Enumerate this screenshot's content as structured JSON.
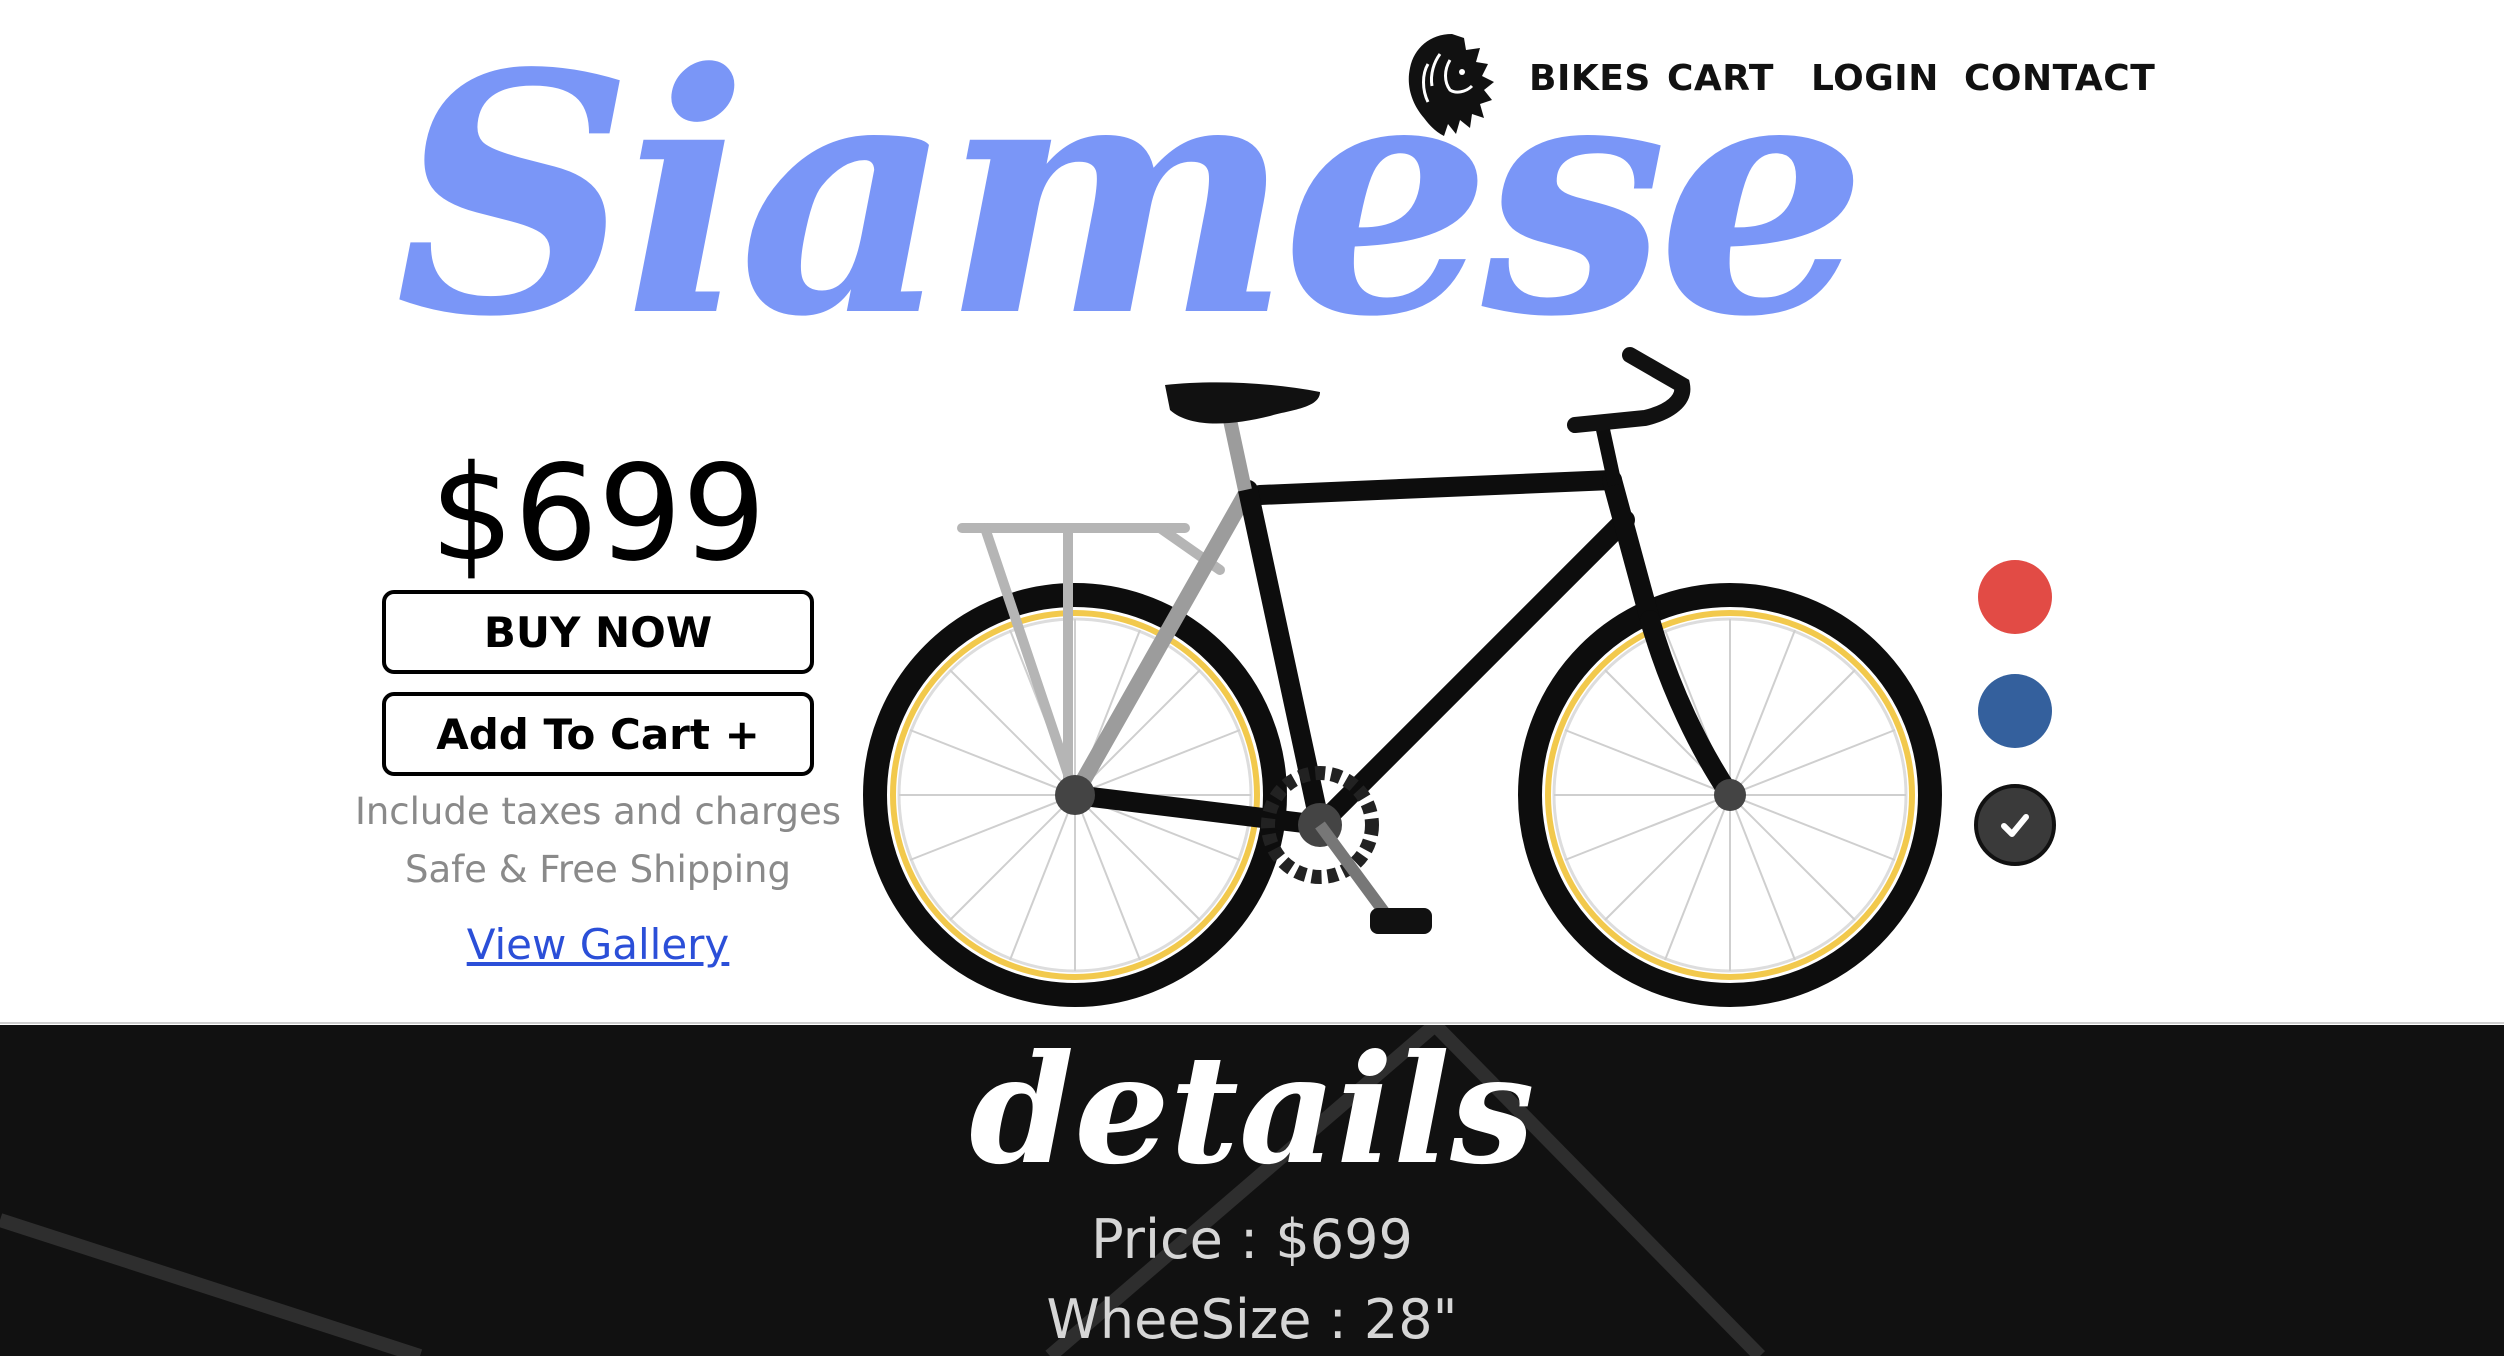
{
  "nav": {
    "logo_icon": "lion-head-icon",
    "items": [
      "BIKES",
      "CART",
      "LOGIN",
      "CONTACT"
    ]
  },
  "hero": {
    "title": "Siamese",
    "price": "$699",
    "buy_now": "BUY NOW",
    "add_to_cart": "Add To Cart +",
    "notes": [
      "Include taxes and charges",
      "Safe & Free Shipping"
    ],
    "view_gallery": "View Gallery",
    "product_image_icon": "bicycle-icon"
  },
  "colors": {
    "options": [
      {
        "name": "red",
        "hex": "#e24b45",
        "selected": false
      },
      {
        "name": "blue",
        "hex": "#34609d",
        "selected": false
      },
      {
        "name": "black",
        "hex": "#3a3a3a",
        "selected": true
      }
    ],
    "selected_icon": "check-icon"
  },
  "details": {
    "title": "details",
    "price_line": "Price : $699",
    "wheel_line": "WheeSize : 28\""
  },
  "theme": {
    "title_color": "#6f8ef7",
    "link_color": "#2b4fd8",
    "details_bg": "#111111",
    "rim_color": "#f2c94c"
  }
}
